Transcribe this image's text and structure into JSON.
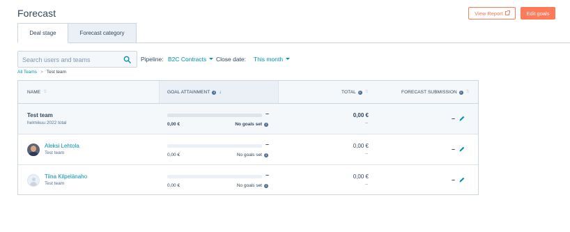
{
  "header": {
    "title": "Forecast",
    "view_report_label": "View Report",
    "edit_goals_label": "Edit goals"
  },
  "tabs": [
    {
      "label": "Deal stage",
      "active": true
    },
    {
      "label": "Forecast category",
      "active": false
    }
  ],
  "filters": {
    "search_placeholder": "Search users and teams",
    "pipeline_label": "Pipeline:",
    "pipeline_value": "B2C Contracts",
    "close_date_label": "Close date:",
    "close_date_value": "This month"
  },
  "breadcrumb": {
    "root": "All Teams",
    "separator": ">",
    "current": "Test team"
  },
  "table": {
    "columns": {
      "name": "NAME",
      "goal_attainment": "GOAL ATTAINMENT",
      "total": "TOTAL",
      "forecast_submission": "FORECAST SUBMISSION"
    },
    "team_row": {
      "name": "Test team",
      "subtitle": "helmikuu 2022 total",
      "goal_value": "0,00 €",
      "goal_status": "No goals set",
      "goal_dash": "–",
      "total": "0,00 €",
      "total_sub": "–",
      "submission": "–"
    },
    "rows": [
      {
        "name": "Aleksi Lehtola",
        "team": "Test team",
        "goal_value": "0,00 €",
        "goal_status": "No goals set",
        "goal_dash": "–",
        "total": "0,00 €",
        "total_sub": "–",
        "submission": "–"
      },
      {
        "name": "Tiina Kilpelänaho",
        "team": "Test team",
        "goal_value": "0,00 €",
        "goal_status": "No goals set",
        "goal_dash": "–",
        "total": "0,00 €",
        "total_sub": "–",
        "submission": "–"
      }
    ]
  },
  "icons": {
    "search": "search-icon",
    "edit": "pencil-icon",
    "info": "info-icon",
    "external": "external-link-icon"
  },
  "colors": {
    "accent": "#ff7a59",
    "link": "#0091ae",
    "text": "#33475b",
    "border": "#cbd6e2",
    "header_bg": "#f5f8fa"
  }
}
